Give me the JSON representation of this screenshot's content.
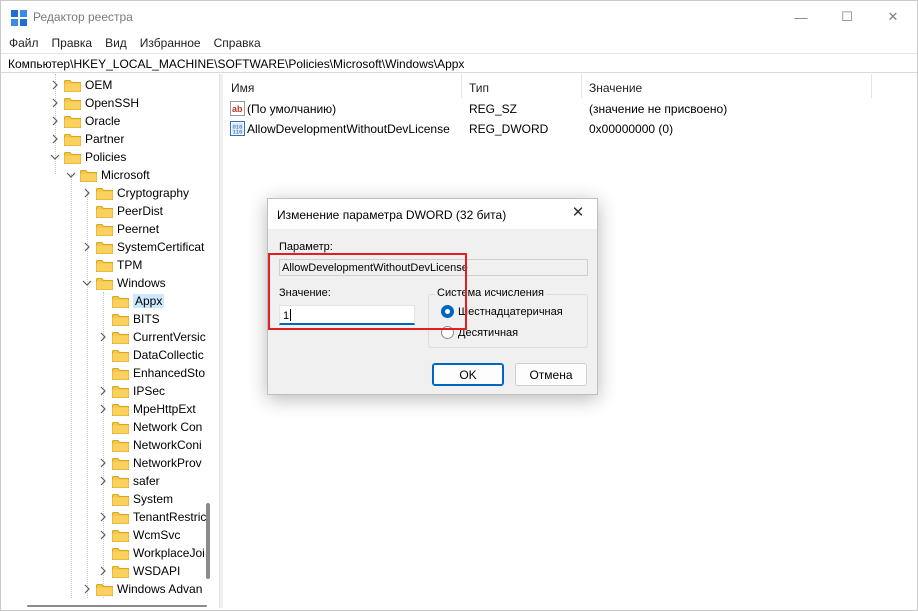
{
  "window": {
    "title": "Редактор реестра",
    "minimize": "—",
    "maximize": "☐",
    "close": "✕"
  },
  "menu": [
    "Файл",
    "Правка",
    "Вид",
    "Избранное",
    "Справка"
  ],
  "address": "Компьютер\\HKEY_LOCAL_MACHINE\\SOFTWARE\\Policies\\Microsoft\\Windows\\Appx",
  "tree": [
    {
      "label": "OEM",
      "expander": "collapsed"
    },
    {
      "label": "OpenSSH",
      "expander": "collapsed"
    },
    {
      "label": "Oracle",
      "expander": "collapsed"
    },
    {
      "label": "Partner",
      "expander": "collapsed"
    },
    {
      "label": "Policies",
      "expander": "expanded"
    },
    {
      "label": "Microsoft",
      "expander": "expanded"
    },
    {
      "label": "Cryptography",
      "expander": "collapsed"
    },
    {
      "label": "PeerDist",
      "expander": "none"
    },
    {
      "label": "Peernet",
      "expander": "none"
    },
    {
      "label": "SystemCertificat",
      "expander": "collapsed"
    },
    {
      "label": "TPM",
      "expander": "none"
    },
    {
      "label": "Windows",
      "expander": "expanded"
    },
    {
      "label": "Appx",
      "expander": "none",
      "selected": true
    },
    {
      "label": "BITS",
      "expander": "none"
    },
    {
      "label": "CurrentVersic",
      "expander": "collapsed"
    },
    {
      "label": "DataCollectic",
      "expander": "none"
    },
    {
      "label": "EnhancedSto",
      "expander": "none"
    },
    {
      "label": "IPSec",
      "expander": "collapsed"
    },
    {
      "label": "MpeHttpExt",
      "expander": "collapsed"
    },
    {
      "label": "Network Con",
      "expander": "none"
    },
    {
      "label": "NetworkConi",
      "expander": "none"
    },
    {
      "label": "NetworkProv",
      "expander": "collapsed"
    },
    {
      "label": "safer",
      "expander": "collapsed"
    },
    {
      "label": "System",
      "expander": "none"
    },
    {
      "label": "TenantRestric",
      "expander": "collapsed"
    },
    {
      "label": "WcmSvc",
      "expander": "collapsed"
    },
    {
      "label": "WorkplaceJoi",
      "expander": "none"
    },
    {
      "label": "WSDAPI",
      "expander": "collapsed"
    },
    {
      "label": "Windows Advan",
      "expander": "collapsed"
    }
  ],
  "list": {
    "headers": {
      "name": "Имя",
      "type": "Тип",
      "value": "Значение"
    },
    "rows": [
      {
        "icon": "string-value-icon",
        "name": "(По умолчанию)",
        "type": "REG_SZ",
        "value": "(значение не присвоено)"
      },
      {
        "icon": "dword-value-icon",
        "name": "AllowDevelopmentWithoutDevLicense",
        "type": "REG_DWORD",
        "value": "0x00000000 (0)"
      }
    ]
  },
  "dialog": {
    "title": "Изменение параметра DWORD (32 бита)",
    "close": "✕",
    "param_label": "Параметр:",
    "param_value": "AllowDevelopmentWithoutDevLicense",
    "value_label": "Значение:",
    "value": "1",
    "base_label": "Система исчисления",
    "base_options": [
      {
        "label": "Шестнадцатеричная",
        "checked": true
      },
      {
        "label": "Десятичная",
        "checked": false
      }
    ],
    "ok": "OK",
    "cancel": "Отмена"
  },
  "colors": {
    "accent": "#0067c0",
    "selection": "#cce8ff",
    "folder": "#f6c543",
    "highlight": "#e02020"
  }
}
